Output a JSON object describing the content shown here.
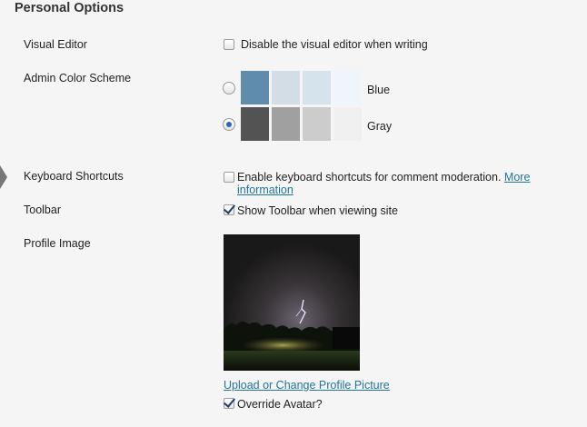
{
  "section": {
    "title": "Personal Options"
  },
  "visual_editor": {
    "label": "Visual Editor",
    "checkbox_label": "Disable the visual editor when writing",
    "checked": false
  },
  "color_scheme": {
    "label": "Admin Color Scheme",
    "options": [
      {
        "name": "Blue",
        "selected": false,
        "colors": [
          "#5f8cad",
          "#d2dde5",
          "#d5e4ec",
          "#eef5fb"
        ]
      },
      {
        "name": "Gray",
        "selected": true,
        "colors": [
          "#535353",
          "#a0a0a0",
          "#cccccc",
          "#f0f0f0"
        ]
      }
    ]
  },
  "keyboard_shortcuts": {
    "label": "Keyboard Shortcuts",
    "checkbox_label": "Enable keyboard shortcuts for comment moderation.",
    "link_text": "More information",
    "checked": false
  },
  "toolbar": {
    "label": "Toolbar",
    "checkbox_label": "Show Toolbar when viewing site",
    "checked": true
  },
  "profile_image": {
    "label": "Profile Image",
    "change_link": "Upload or Change Profile Picture",
    "override_label": "Override Avatar?",
    "override_checked": true
  },
  "colors": {
    "link": "#21759b",
    "radio_selected": "#2a6ab5"
  }
}
